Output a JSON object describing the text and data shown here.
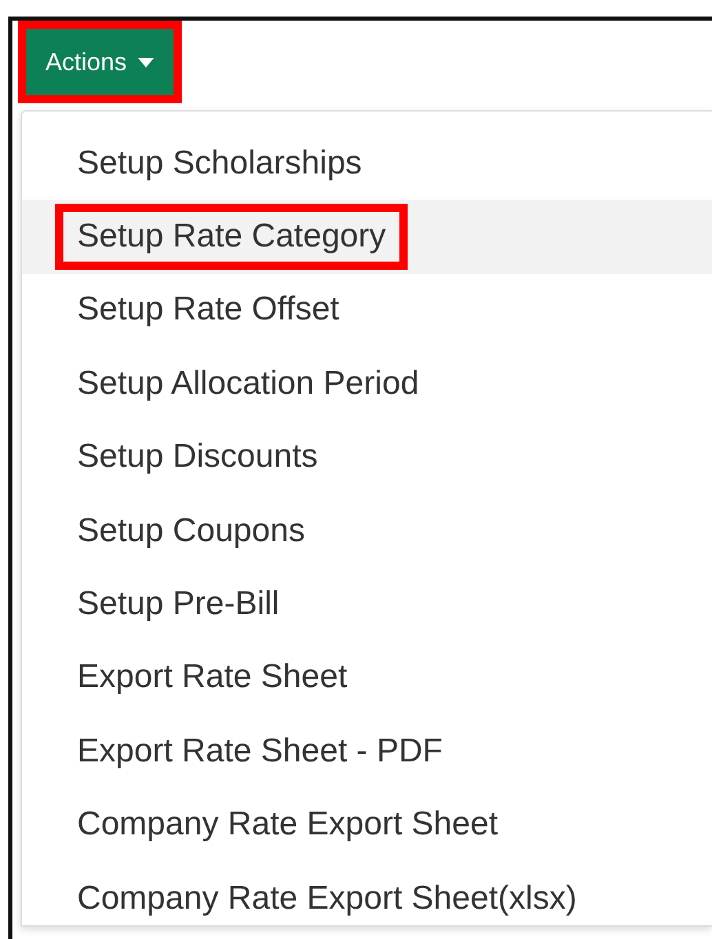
{
  "actions_button": {
    "label": "Actions",
    "highlighted": true
  },
  "menu": {
    "items": [
      {
        "label": "Setup Scholarships",
        "selected": false,
        "highlighted": false
      },
      {
        "label": "Setup Rate Category",
        "selected": true,
        "highlighted": true
      },
      {
        "label": "Setup Rate Offset",
        "selected": false,
        "highlighted": false
      },
      {
        "label": "Setup Allocation Period",
        "selected": false,
        "highlighted": false
      },
      {
        "label": "Setup Discounts",
        "selected": false,
        "highlighted": false
      },
      {
        "label": "Setup Coupons",
        "selected": false,
        "highlighted": false
      },
      {
        "label": "Setup Pre-Bill",
        "selected": false,
        "highlighted": false
      },
      {
        "label": "Export Rate Sheet",
        "selected": false,
        "highlighted": false
      },
      {
        "label": "Export Rate Sheet - PDF",
        "selected": false,
        "highlighted": false
      },
      {
        "label": "Company Rate Export Sheet",
        "selected": false,
        "highlighted": false
      },
      {
        "label": "Company Rate Export Sheet(xlsx)",
        "selected": false,
        "highlighted": false
      }
    ]
  }
}
